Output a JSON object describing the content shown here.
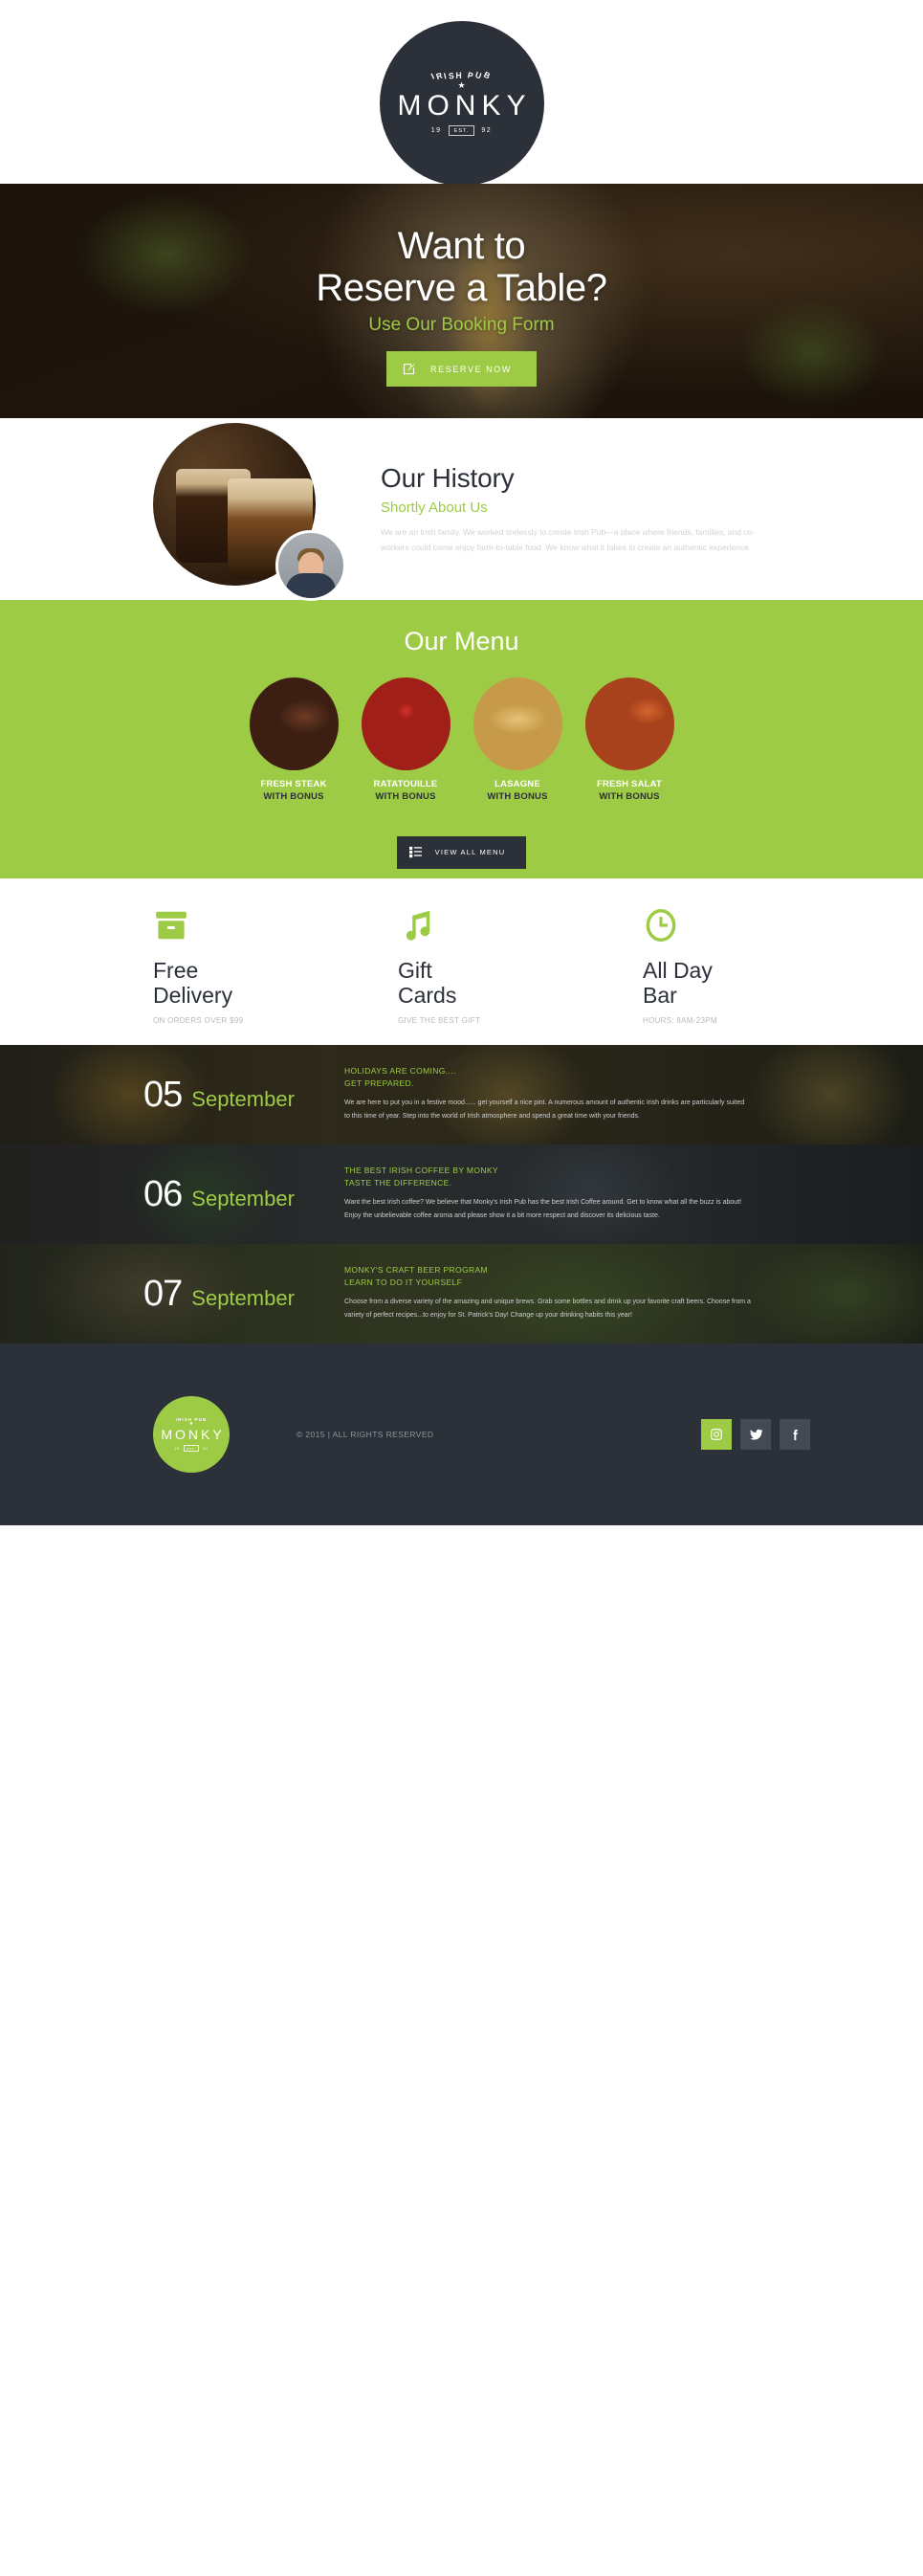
{
  "theme": {
    "green": "#9ECB45",
    "dark": "#2B3039",
    "muted": "#B9B9B9"
  },
  "header": {
    "logo": {
      "arc_text": "IRISH PUB",
      "star": "★",
      "name": "MONKY",
      "est_left": "19",
      "est_label": "EST.",
      "est_right": "92"
    }
  },
  "hero": {
    "title_line1": "Want to",
    "title_line2": "Reserve a Table?",
    "subtitle": "Use Our Booking Form",
    "button_label": "RESERVE NOW",
    "button_icon": "pencil-edit-icon"
  },
  "history": {
    "title": "Our History",
    "subtitle": "Shortly About Us",
    "body": "We are an Irish family. We worked tirelessly to create Irish Pub—a place where friends, families, and co-workers could come enjoy farm-to-table food. We know what it takes to create an authentic experience.",
    "image_alt": "two-glasses-of-beer",
    "avatar_alt": "smiling-man-portrait"
  },
  "menu": {
    "title": "Our Menu",
    "items": [
      {
        "name": "FRESH STEAK",
        "sub": "WITH BONUS",
        "thumb": "steak-photo"
      },
      {
        "name": "RATATOUILLE",
        "sub": "WITH BONUS",
        "thumb": "ratatouille-photo"
      },
      {
        "name": "LASAGNE",
        "sub": "WITH BONUS",
        "thumb": "lasagne-photo"
      },
      {
        "name": "FRESH SALAT",
        "sub": "WITH BONUS",
        "thumb": "salad-photo"
      }
    ],
    "button_label": "VIEW ALL MENU",
    "button_icon": "list-icon"
  },
  "features": [
    {
      "icon": "box-icon",
      "title_line1": "Free",
      "title_line2": "Delivery",
      "note": "ON ORDERS OVER $99"
    },
    {
      "icon": "music-note-icon",
      "title_line1": "Gift",
      "title_line2": "Cards",
      "note": "GIVE THE BEST GIFT"
    },
    {
      "icon": "clock-icon",
      "title_line1": "All Day",
      "title_line2": "Bar",
      "note": "HOURS: 8AM-23PM"
    }
  ],
  "news": [
    {
      "day": "05",
      "month": "September",
      "heading_line1": "HOLIDAYS ARE COMING....",
      "heading_line2": "GET PREPARED.",
      "body": "We are here to put you in a festive mood...... get yourself a nice pint. A numerous amount of authentic Irish drinks are particularly suited to this time of year. Step into the world of Irish atmosphere and spend a great time with your friends."
    },
    {
      "day": "06",
      "month": "September",
      "heading_line1": "THE BEST IRISH COFFEE BY MONKY",
      "heading_line2": "TASTE THE DIFFERENCE.",
      "body": "Want the best Irish coffee? We believe that Monky's Irish Pub has the best Irish Coffee around. Get to know what all the buzz is about! Enjoy the unbelievable coffee aroma and please show it a bit more respect and discover its delicious taste."
    },
    {
      "day": "07",
      "month": "September",
      "heading_line1": "MONKY'S CRAFT BEER PROGRAM",
      "heading_line2": "LEARN TO DO IT YOURSELF",
      "body": "Choose from a diverse variety of the amazing and unique brews. Grab some bottles and drink up your favorite craft beers. Choose from a variety of perfect recipes...to enjoy for St. Patrick's Day! Change up your drinking habits this year!"
    }
  ],
  "footer": {
    "logo": {
      "arc_text": "IRISH PUB",
      "star": "★",
      "name": "MONKY",
      "est_left": "19",
      "est_label": "EST.",
      "est_right": "92"
    },
    "copyright": "© 2015 | ALL RIGHTS RESERVED",
    "social": [
      {
        "name": "instagram",
        "glyph": "▣",
        "active": true
      },
      {
        "name": "twitter",
        "glyph": "t",
        "active": false
      },
      {
        "name": "facebook",
        "glyph": "f",
        "active": false
      }
    ]
  }
}
